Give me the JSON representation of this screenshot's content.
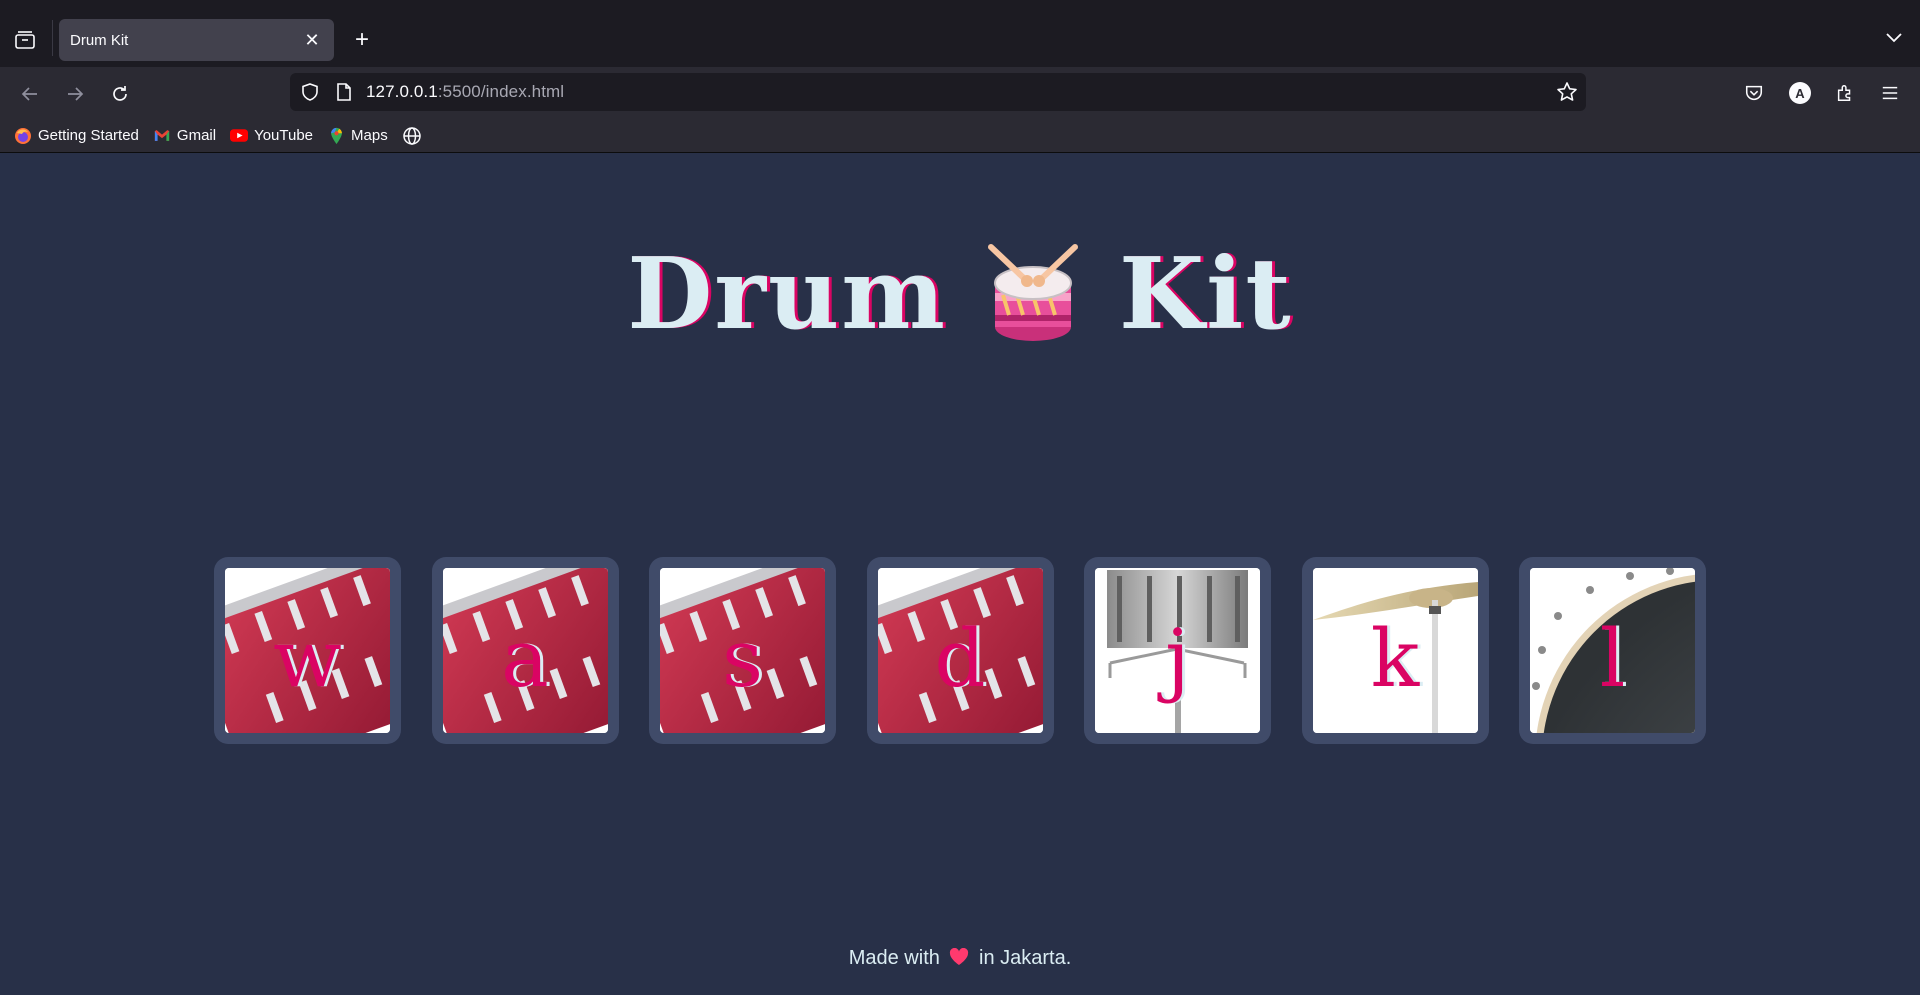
{
  "browser": {
    "tab_title": "Drum Kit",
    "url_host": "127.0.0.1",
    "url_rest": ":5500/index.html",
    "avatar_letter": "A",
    "bookmarks": [
      {
        "label": "Getting Started",
        "icon": "firefox-icon"
      },
      {
        "label": "Gmail",
        "icon": "gmail-icon"
      },
      {
        "label": "YouTube",
        "icon": "youtube-icon"
      },
      {
        "label": "Maps",
        "icon": "maps-icon"
      }
    ]
  },
  "page": {
    "title_left": "Drum",
    "title_right": "Kit",
    "drums": [
      {
        "key": "w",
        "image": "tom-drum"
      },
      {
        "key": "a",
        "image": "tom-drum"
      },
      {
        "key": "s",
        "image": "tom-drum"
      },
      {
        "key": "d",
        "image": "tom-drum"
      },
      {
        "key": "j",
        "image": "snare-drum"
      },
      {
        "key": "k",
        "image": "crash-cymbal"
      },
      {
        "key": "l",
        "image": "kick-drum"
      }
    ],
    "footer_before": "Made with",
    "footer_after": "in Jakarta."
  },
  "colors": {
    "background": "#283048",
    "title_text": "#dbedf3",
    "accent": "#da0463",
    "drum_frame": "#404b69"
  }
}
